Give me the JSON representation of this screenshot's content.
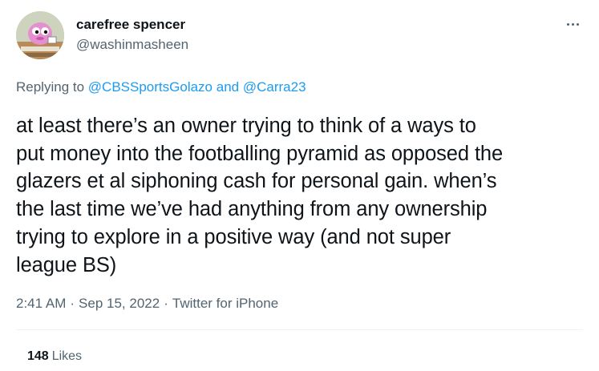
{
  "author": {
    "name": "carefree spencer",
    "handle": "@washinmasheen"
  },
  "reply": {
    "prefix": "Replying to",
    "mention1": "@CBSSportsGolazo",
    "and": "and",
    "mention2": "@Carra23"
  },
  "tweet": {
    "text": "at least there’s an owner trying to think of a ways to\nput money into the footballing pyramid as opposed the\nglazers et al siphoning cash for personal gain. when’s\nthe last time we’ve had anything from any ownership\ntrying to explore in a positive way (and not super\nleague BS)",
    "time": "2:41 AM",
    "date": "Sep 15, 2022",
    "source": "Twitter for iPhone",
    "separator": "·"
  },
  "stats": {
    "likes_count": "148",
    "likes_label": "Likes"
  },
  "icons": {
    "more": "more-horizontal-icon"
  },
  "colors": {
    "link": "#1d9bf0",
    "secondary_text": "#536471",
    "primary_text": "#0f1419",
    "divider": "#eff3f4"
  }
}
